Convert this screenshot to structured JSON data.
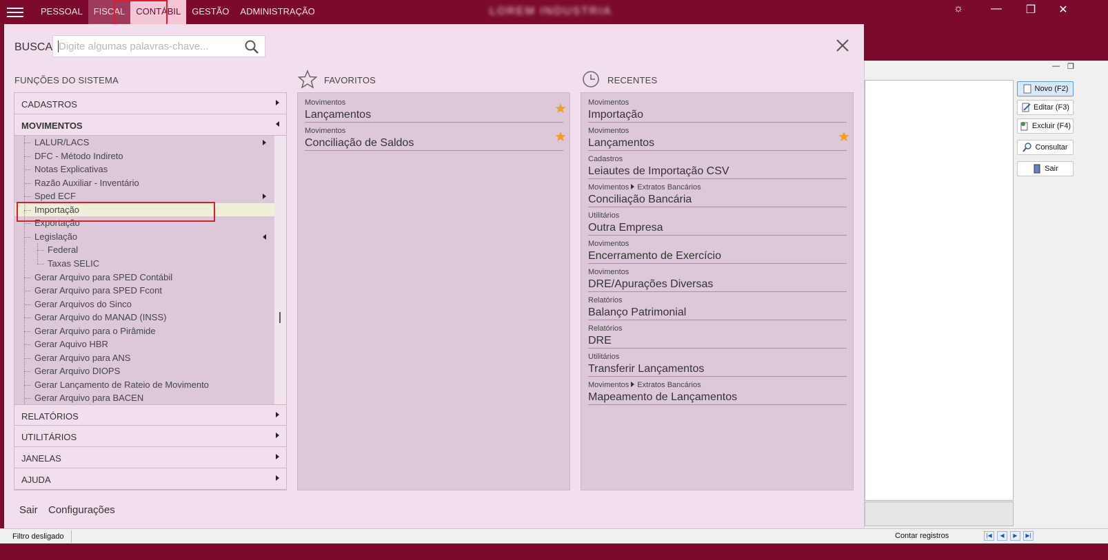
{
  "topbar": {
    "menu": [
      "PESSOAL",
      "FISCAL",
      "CONTÁBIL",
      "GESTÃO",
      "ADMINISTRAÇÃO"
    ],
    "window_title": "LOREM INDUSTRIA",
    "controls": {
      "theme": "☼",
      "minimize": "—",
      "restore": "❐",
      "close": "✕"
    }
  },
  "search": {
    "label": "BUSCA",
    "placeholder": "Digite algumas palavras-chave..."
  },
  "sections": {
    "functions_title": "FUNÇÕES DO SISTEMA",
    "favorites_title": "FAVORITOS",
    "recent_title": "RECENTES"
  },
  "accordion": {
    "cadastros": "CADASTROS",
    "movimentos": "MOVIMENTOS",
    "relatorios": "RELATÓRIOS",
    "utilitarios": "UTILITÁRIOS",
    "janelas": "JANELAS",
    "ajuda": "AJUDA"
  },
  "tree": [
    {
      "label": "LALUR/LACS",
      "level": 1,
      "arrow": "right"
    },
    {
      "label": "DFC - Método Indireto",
      "level": 1
    },
    {
      "label": "Notas Explicativas",
      "level": 1
    },
    {
      "label": "Razão Auxiliar - Inventário",
      "level": 1
    },
    {
      "label": "Sped ECF",
      "level": 1,
      "arrow": "right"
    },
    {
      "label": "Importação",
      "level": 1,
      "selected": true
    },
    {
      "label": "Exportação",
      "level": 1
    },
    {
      "label": "Legislação",
      "level": 1,
      "arrow": "left"
    },
    {
      "label": "Federal",
      "level": 2
    },
    {
      "label": "Taxas SELIC",
      "level": 2
    },
    {
      "label": "Gerar Arquivo para SPED Contábil",
      "level": 1
    },
    {
      "label": "Gerar Arquivo para SPED Fcont",
      "level": 1
    },
    {
      "label": "Gerar Arquivos do Sinco",
      "level": 1
    },
    {
      "label": "Gerar Arquivo do MANAD (INSS)",
      "level": 1
    },
    {
      "label": "Gerar Arquivo para o Pirâmide",
      "level": 1
    },
    {
      "label": "Gerar Aquivo HBR",
      "level": 1
    },
    {
      "label": "Gerar Arquivo para ANS",
      "level": 1
    },
    {
      "label": "Gerar Arquivo DIOPS",
      "level": 1
    },
    {
      "label": "Gerar Lançamento de Rateio de Movimento",
      "level": 1
    },
    {
      "label": "Gerar Arquivo para BACEN",
      "level": 1
    }
  ],
  "favorites": [
    {
      "category": "Movimentos",
      "name": "Lançamentos",
      "starred": true
    },
    {
      "category": "Movimentos",
      "name": "Conciliação de Saldos",
      "starred": true
    }
  ],
  "recent": [
    {
      "category": "Movimentos",
      "name": "Importação"
    },
    {
      "category": "Movimentos",
      "name": "Lançamentos",
      "starred": true
    },
    {
      "category": "Cadastros",
      "name": "Leiautes de Importação CSV"
    },
    {
      "category": "Movimentos",
      "sub": "Extratos Bancários",
      "name": "Conciliação Bancária"
    },
    {
      "category": "Utilitários",
      "name": "Outra Empresa"
    },
    {
      "category": "Movimentos",
      "name": "Encerramento de Exercício"
    },
    {
      "category": "Movimentos",
      "name": "DRE/Apurações Diversas"
    },
    {
      "category": "Relatórios",
      "name": "Balanço Patrimonial"
    },
    {
      "category": "Relatórios",
      "name": "DRE"
    },
    {
      "category": "Utilitários",
      "name": "Transferir Lançamentos"
    },
    {
      "category": "Movimentos",
      "sub": "Extratos Bancários",
      "name": "Mapeamento de Lançamentos"
    }
  ],
  "footer_links": {
    "sair": "Sair",
    "config": "Configurações"
  },
  "side_buttons": {
    "novo": "Novo  (F2)",
    "editar": "Editar  (F3)",
    "excluir": "Excluir (F4)",
    "consultar": "Consultar",
    "sair": "Sair"
  },
  "status": {
    "filter": "Filtro desligado",
    "count": "Contar registros"
  },
  "colors": {
    "brand": "#7b0a2c",
    "panel": "#f2dfee",
    "star": "#f0a020",
    "highlight": "#e21b2b"
  }
}
